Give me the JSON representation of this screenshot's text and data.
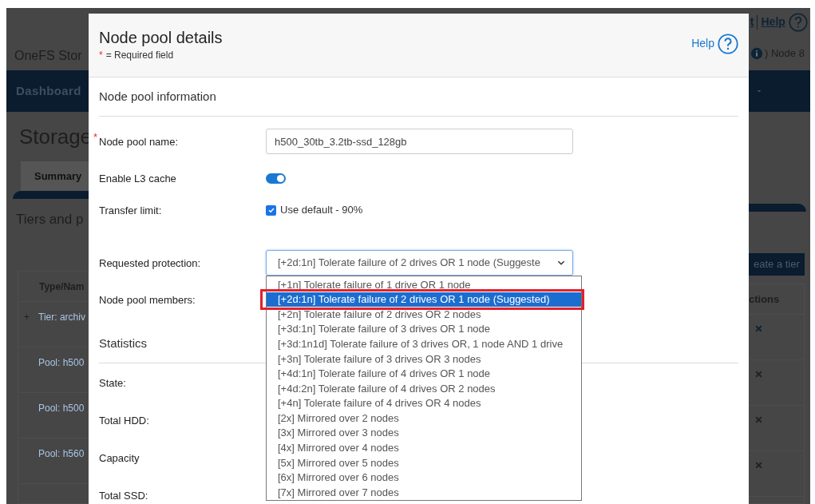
{
  "background_app": {
    "header_title": "OneFS Stor",
    "top_links": [
      {
        "label": "t"
      },
      {
        "label": "Help"
      }
    ],
    "node_label": ") Node 8",
    "nav_item": "Dashboard",
    "page_title": "Storage",
    "tab": "Summary",
    "section_title": "Tiers and p",
    "create_button": "eate a tier",
    "table": {
      "columns": [
        "Type/Nam",
        "ctions"
      ],
      "rows": [
        {
          "expander": "+",
          "name": "Tier: archiv"
        },
        {
          "name": "Pool: h500"
        },
        {
          "name": "Pool: h500"
        },
        {
          "name": "Pool: h560"
        }
      ]
    }
  },
  "dialog": {
    "title": "Node pool details",
    "required_mark": "*",
    "required_note": "= Required field",
    "help": "Help",
    "sections": [
      {
        "title": "Node pool information",
        "fields": [
          {
            "kind": "text",
            "label": "Node pool name:",
            "required": true,
            "value": "h500_30tb_3.2tb-ssd_128gb"
          },
          {
            "kind": "toggle",
            "label": "Enable L3 cache",
            "on": true
          },
          {
            "kind": "checkbox",
            "label": "Transfer limit:",
            "checked": true,
            "text": "Use default - 90%"
          },
          {
            "kind": "select",
            "label": "Requested protection:",
            "value": "[+2d:1n] Tolerate failure of 2 drives OR 1 node (Suggeste",
            "expanded": true,
            "options": [
              {
                "label": "[+1n] Tolerate failure of 1 drive OR 1 node",
                "selected": false,
                "outlined": false
              },
              {
                "label": "[+2d:1n] Tolerate failure of 2 drives OR 1 node (Suggested)",
                "selected": true,
                "outlined": true
              },
              {
                "label": "[+2n] Tolerate failure of 2 drives OR 2 nodes",
                "selected": false,
                "outlined": false
              },
              {
                "label": "[+3d:1n] Tolerate failure of 3 drives OR 1 node",
                "selected": false,
                "outlined": false
              },
              {
                "label": "[+3d:1n1d] Tolerate failure of 3 drives OR, 1 node AND 1 drive",
                "selected": false,
                "outlined": false
              },
              {
                "label": "[+3n] Tolerate failure of 3 drives OR 3 nodes",
                "selected": false,
                "outlined": false
              },
              {
                "label": "[+4d:1n] Tolerate failure of 4 drives OR 1 node",
                "selected": false,
                "outlined": false
              },
              {
                "label": "[+4d:2n] Tolerate failure of 4 drives OR 2 nodes",
                "selected": false,
                "outlined": false
              },
              {
                "label": "[+4n] Tolerate failure of 4 drives OR 4 nodes",
                "selected": false,
                "outlined": false
              },
              {
                "label": "[2x] Mirrored over 2 nodes",
                "selected": false,
                "outlined": false
              },
              {
                "label": "[3x] Mirrored over 3 nodes",
                "selected": false,
                "outlined": false
              },
              {
                "label": "[4x] Mirrored over 4 nodes",
                "selected": false,
                "outlined": false
              },
              {
                "label": "[5x] Mirrored over 5 nodes",
                "selected": false,
                "outlined": false
              },
              {
                "label": "[6x] Mirrored over 6 nodes",
                "selected": false,
                "outlined": false
              },
              {
                "label": "[7x] Mirrored over 7 nodes",
                "selected": false,
                "outlined": false
              }
            ]
          },
          {
            "kind": "label",
            "label": "Node pool members:"
          }
        ]
      },
      {
        "title": "Statistics",
        "fields": [
          {
            "kind": "label",
            "label": "State:"
          },
          {
            "kind": "label",
            "label": "Total HDD:"
          },
          {
            "kind": "label",
            "label": "Capacity"
          },
          {
            "kind": "label",
            "label": "Total SSD:"
          }
        ]
      }
    ]
  }
}
